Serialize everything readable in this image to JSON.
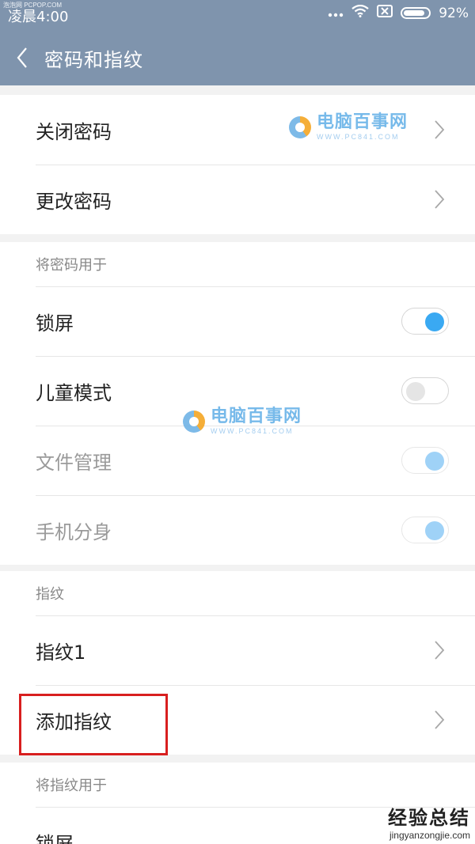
{
  "status": {
    "corner_text": "泡泡网 PCPOP.COM",
    "time": "凌晨4:00",
    "battery": "92%",
    "battery_level": 0.92
  },
  "header": {
    "title": "密码和指纹"
  },
  "password_section": {
    "items": [
      {
        "label": "关闭密码"
      },
      {
        "label": "更改密码"
      }
    ]
  },
  "use_password_section": {
    "header": "将密码用于",
    "items": [
      {
        "label": "锁屏",
        "state": "on"
      },
      {
        "label": "儿童模式",
        "state": "off"
      },
      {
        "label": "文件管理",
        "state": "on-disabled"
      },
      {
        "label": "手机分身",
        "state": "on-disabled"
      }
    ]
  },
  "fingerprint_section": {
    "header": "指纹",
    "items": [
      {
        "label": "指纹1"
      },
      {
        "label": "添加指纹"
      }
    ]
  },
  "use_fingerprint_section": {
    "header": "将指纹用于",
    "items": [
      {
        "label": "锁屏"
      }
    ]
  },
  "watermarks": {
    "pc841_name": "电脑百事网",
    "pc841_url": "WWW.PC841.COM",
    "corner_name": "经验总结",
    "corner_url": "jingyanzongjie.com"
  },
  "colors": {
    "header_bg": "#7f94ad",
    "toggle_on": "#3aa9f2",
    "highlight_box": "#d81f1f"
  }
}
